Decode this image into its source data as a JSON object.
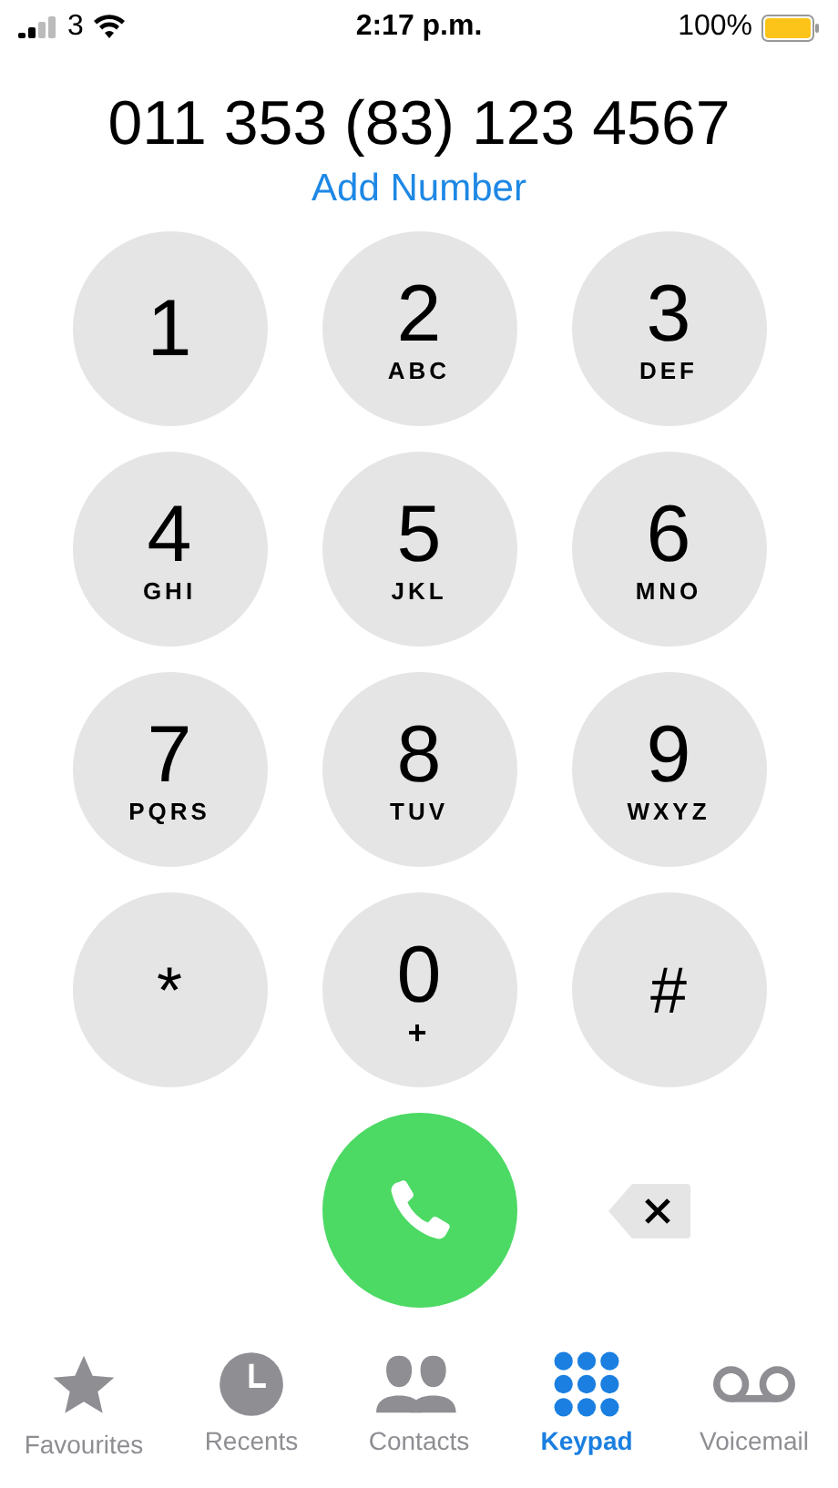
{
  "status_bar": {
    "carrier": "3",
    "time": "2:17 p.m.",
    "battery": "100%"
  },
  "number": "011 353 (83) 123 4567",
  "add_number": "Add Number",
  "keys": [
    {
      "digit": "1"
    },
    {
      "digit": "2",
      "letters": "ABC"
    },
    {
      "digit": "3",
      "letters": "DEF"
    },
    {
      "digit": "4",
      "letters": "GHI"
    },
    {
      "digit": "5",
      "letters": "JKL"
    },
    {
      "digit": "6",
      "letters": "MNO"
    },
    {
      "digit": "7",
      "letters": "PQRS"
    },
    {
      "digit": "8",
      "letters": "TUV"
    },
    {
      "digit": "9",
      "letters": "WXYZ"
    },
    {
      "digit": "*"
    },
    {
      "digit": "0",
      "letters": "+"
    },
    {
      "digit": "#"
    }
  ],
  "tabs": [
    {
      "label": "Favourites",
      "kind": "star",
      "selected": false
    },
    {
      "label": "Recents",
      "kind": "clock",
      "selected": false
    },
    {
      "label": "Contacts",
      "kind": "people",
      "selected": false
    },
    {
      "label": "Keypad",
      "kind": "keypad",
      "selected": true
    },
    {
      "label": "Voicemail",
      "kind": "voicemail",
      "selected": false
    }
  ]
}
